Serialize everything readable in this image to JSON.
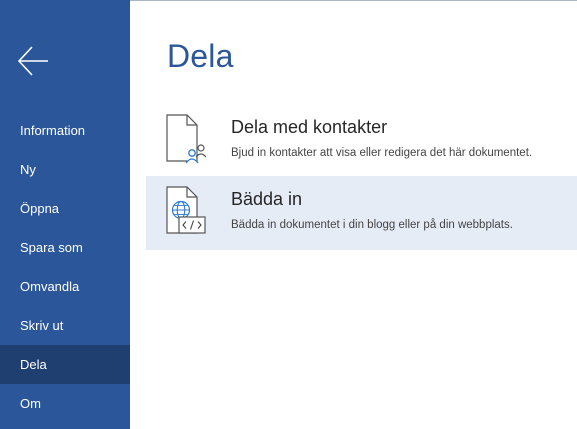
{
  "sidebar": {
    "back_icon": "arrow-left-icon",
    "items": [
      {
        "label": "Information"
      },
      {
        "label": "Ny"
      },
      {
        "label": "Öppna"
      },
      {
        "label": "Spara som"
      },
      {
        "label": "Omvandla"
      },
      {
        "label": "Skriv ut"
      },
      {
        "label": "Dela",
        "active": true
      },
      {
        "label": "Om"
      }
    ]
  },
  "main": {
    "title": "Dela",
    "options": [
      {
        "title": "Dela med kontakter",
        "description": "Bjud in kontakter att visa eller redigera det här dokumentet.",
        "icon": "share-with-people-icon"
      },
      {
        "title": "Bädda in",
        "description": "Bädda in dokumentet i din blogg eller på din webbplats.",
        "icon": "embed-icon",
        "selected": true
      }
    ]
  },
  "colors": {
    "sidebar_bg": "#2b579a",
    "sidebar_active": "#1f3f70",
    "title": "#2b579a",
    "selected_bg": "#e6ecf6"
  }
}
